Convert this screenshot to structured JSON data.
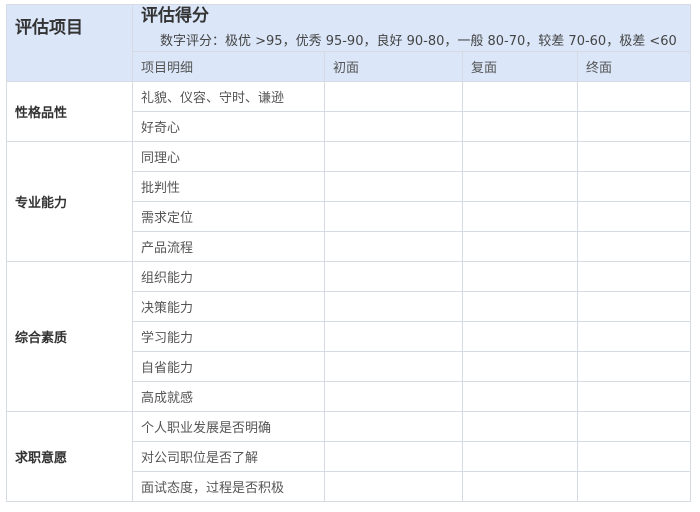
{
  "header": {
    "col1_title": "评估项目",
    "score_title": "评估得分",
    "score_desc": "数字评分：极优 >95，优秀 95-90，良好 90-80，一般 80-70，较差 70-60，极差  <60"
  },
  "subheader": {
    "detail": "项目明细",
    "first": "初面",
    "second": "复面",
    "final": "终面"
  },
  "categories": [
    {
      "name": "性格品性",
      "items": [
        "礼貌、仪容、守时、谦逊",
        "好奇心"
      ]
    },
    {
      "name": "专业能力",
      "items": [
        "同理心",
        "批判性",
        "需求定位",
        "产品流程"
      ]
    },
    {
      "name": "综合素质",
      "items": [
        "组织能力",
        "决策能力",
        "学习能力",
        "自省能力",
        "高成就感"
      ]
    },
    {
      "name": "求职意愿",
      "items": [
        "个人职业发展是否明确",
        "对公司职位是否了解",
        "面试态度，过程是否积极"
      ]
    }
  ]
}
